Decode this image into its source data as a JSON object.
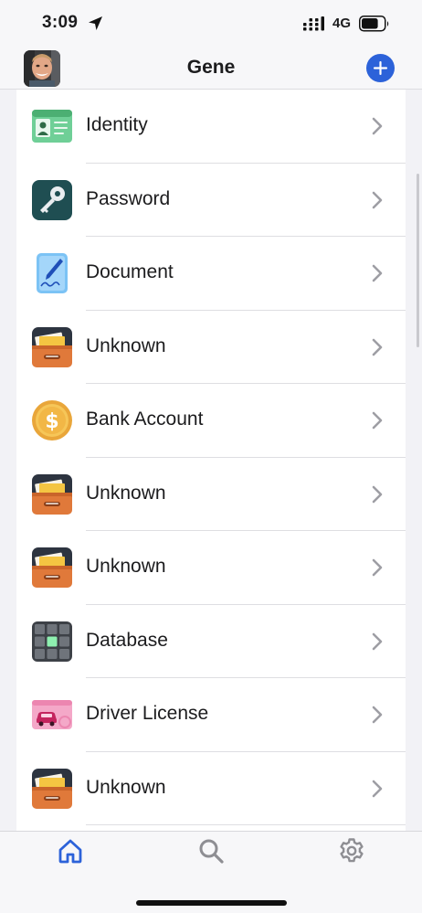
{
  "status_bar": {
    "time": "3:09",
    "network": "4G",
    "battery_level": 0.75,
    "icons": [
      "location-arrow-icon",
      "signal-icon",
      "battery-icon"
    ]
  },
  "header": {
    "title": "Gene",
    "avatar_icon": "user-photo",
    "add_icon": "plus-icon",
    "accent_color": "#2c62d9"
  },
  "items": [
    {
      "label": "Identity",
      "icon": "identity-card-icon"
    },
    {
      "label": "Password",
      "icon": "key-icon"
    },
    {
      "label": "Document",
      "icon": "document-pen-icon"
    },
    {
      "label": "Unknown",
      "icon": "folder-drawer-icon"
    },
    {
      "label": "Bank Account",
      "icon": "dollar-coin-icon"
    },
    {
      "label": "Unknown",
      "icon": "folder-drawer-icon"
    },
    {
      "label": "Unknown",
      "icon": "folder-drawer-icon"
    },
    {
      "label": "Database",
      "icon": "database-grid-icon"
    },
    {
      "label": "Driver License",
      "icon": "driver-license-icon"
    },
    {
      "label": "Unknown",
      "icon": "folder-drawer-icon"
    }
  ],
  "tab_bar": {
    "tabs": [
      {
        "name": "home",
        "icon": "home-icon",
        "active": true
      },
      {
        "name": "search",
        "icon": "search-icon",
        "active": false
      },
      {
        "name": "settings",
        "icon": "gear-icon",
        "active": false
      }
    ],
    "active_color": "#2c62d9",
    "inactive_color": "#8e8e93"
  }
}
